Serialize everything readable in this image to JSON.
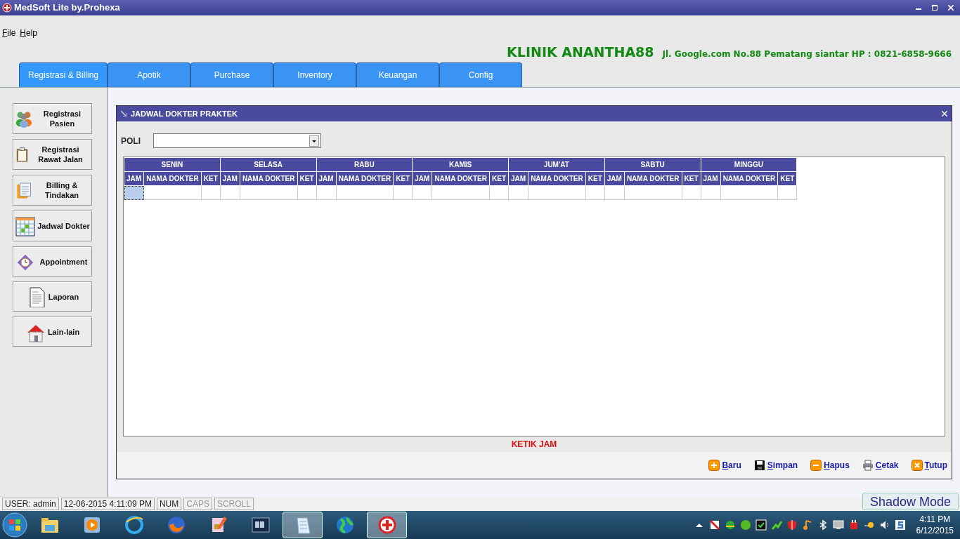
{
  "window": {
    "title": "MedSoft Lite by.Prohexa"
  },
  "menu": [
    {
      "label": "File"
    },
    {
      "label": "Help"
    }
  ],
  "clinic": {
    "name": "KLINIK ANANTHA88",
    "address": "Jl. Google.com No.88  Pematang siantar HP : 0821-6858-9666"
  },
  "tabs": [
    {
      "label": "Registrasi & Billing",
      "selected": true
    },
    {
      "label": "Apotik",
      "selected": false
    },
    {
      "label": "Purchase",
      "selected": false
    },
    {
      "label": "Inventory",
      "selected": false
    },
    {
      "label": "Keuangan",
      "selected": false
    },
    {
      "label": "Config",
      "selected": false
    }
  ],
  "sidebar": {
    "items": [
      {
        "label": "Registrasi Pasien"
      },
      {
        "label": "Registrasi Rawat Jalan"
      },
      {
        "label": "Billing & Tindakan"
      },
      {
        "label": "Jadwal Dokter"
      },
      {
        "label": "Appointment"
      },
      {
        "label": "Laporan"
      },
      {
        "label": "Lain-lain"
      }
    ]
  },
  "panel": {
    "title": "JADWAL DOKTER PRAKTEK",
    "poli_label": "POLI",
    "table": {
      "days": [
        {
          "name": "SENIN",
          "columns": [
            "JAM",
            "NAMA DOKTER",
            "KET"
          ]
        },
        {
          "name": "SELASA",
          "columns": [
            "JAM",
            "NAMA DOKTER",
            "KET"
          ]
        },
        {
          "name": "RABU",
          "columns": [
            "JAM",
            "NAMA DOKTER",
            "KET"
          ]
        },
        {
          "name": "KAMIS",
          "columns": [
            "JAM",
            "NAMA DOKTER",
            "KET"
          ]
        },
        {
          "name": "JUM'AT",
          "columns": [
            "JAM",
            "NAMA DOKTER",
            "KET"
          ]
        },
        {
          "name": "SABTU",
          "columns": [
            "JAM",
            "NAMA DOKTER",
            "KET"
          ]
        },
        {
          "name": "MINGGU",
          "columns": [
            "JAM",
            "NAMA DOKTER",
            "KET"
          ]
        }
      ],
      "rows": [
        {
          "cells": [
            {
              "selected": true
            },
            {
              "selected": false
            },
            {
              "selected": false
            },
            {
              "selected": false
            },
            {
              "selected": false
            },
            {
              "selected": false
            },
            {
              "selected": false
            },
            {
              "selected": false
            },
            {
              "selected": false
            },
            {
              "selected": false
            },
            {
              "selected": false
            },
            {
              "selected": false
            },
            {
              "selected": false
            },
            {
              "selected": false
            },
            {
              "selected": false
            },
            {
              "selected": false
            },
            {
              "selected": false
            },
            {
              "selected": false
            },
            {
              "selected": false
            },
            {
              "selected": false
            },
            {
              "selected": false
            }
          ]
        }
      ]
    },
    "hint": "KETIK JAM",
    "actions": [
      {
        "label": "Baru",
        "kind": "add"
      },
      {
        "label": "Simpan",
        "kind": "save"
      },
      {
        "label": "Hapus",
        "kind": "delete"
      },
      {
        "label": "Cetak",
        "kind": "print"
      },
      {
        "label": "Tutup",
        "kind": "close"
      }
    ]
  },
  "status_bar": [
    {
      "text": "USER: admin",
      "on": true
    },
    {
      "text": "12-06-2015 4:11:09 PM",
      "on": true
    },
    {
      "text": "NUM",
      "on": true
    },
    {
      "text": "CAPS",
      "on": false
    },
    {
      "text": "SCROLL",
      "on": false
    }
  ],
  "shadow_button": {
    "label": "Shadow Mode"
  },
  "taskbar": {
    "apps": [
      {
        "active": false
      },
      {
        "active": false
      },
      {
        "active": false
      },
      {
        "active": false
      },
      {
        "active": false
      },
      {
        "active": false
      },
      {
        "active": true
      },
      {
        "active": false
      },
      {
        "active": true
      }
    ],
    "clock": {
      "time": "4:11 PM",
      "date": "6/12/2015"
    }
  }
}
